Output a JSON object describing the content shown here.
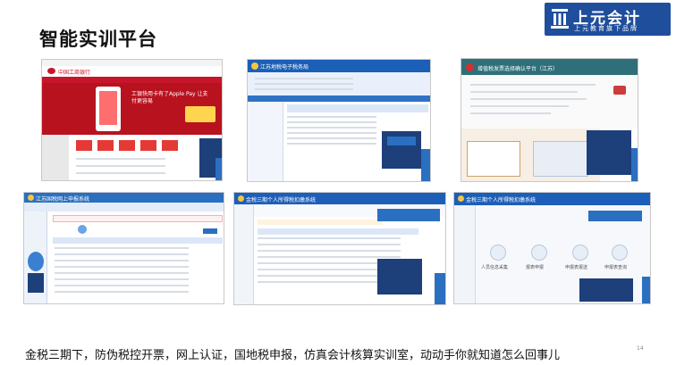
{
  "slide": {
    "title": "智能实训平台",
    "caption": "金税三期下，防伪税控开票，网上认证，国地税申报，仿真会计核算实训室，动动手你就知道怎么回事儿",
    "page_number": "14"
  },
  "logo": {
    "name": "上元会计",
    "tagline": "上元教育旗下品牌",
    "icon": "book-building-icon"
  },
  "screenshots": [
    {
      "id": "icbc-bank",
      "icon": "bank-logo-icon",
      "header_text": "中国工商银行",
      "banner_text": "工银快用卡有了Apple Pay 让支付更容易",
      "nav_color": "#c7162b"
    },
    {
      "id": "jiangsu-tax-bureau",
      "icon": "tax-emblem-icon",
      "header_text": "江苏地税电子税务局",
      "nav_color": "#1c5fb6"
    },
    {
      "id": "invoice-check-platform",
      "icon": "tax-emblem-icon",
      "header_text": "增值税发票选择确认平台（江苏）",
      "nav_color": "#2f6f7a"
    },
    {
      "id": "tax-software-client",
      "icon": "tax-emblem-icon",
      "header_text": "江苏国税网上申报系统",
      "nav_color": "#2a6fc0"
    },
    {
      "id": "personal-tax-system-1",
      "icon": "tax-emblem-icon",
      "header_text": "金税三期个人所得税扣缴系统",
      "nav_color": "#1d5fb8"
    },
    {
      "id": "personal-tax-system-2",
      "icon": "tax-emblem-icon",
      "header_text": "金税三期个人所得税扣缴系统",
      "nav_color": "#1d5fb8",
      "tiles": [
        "人员信息采集",
        "报表申报",
        "申报表报送",
        "申报表查询"
      ]
    }
  ]
}
